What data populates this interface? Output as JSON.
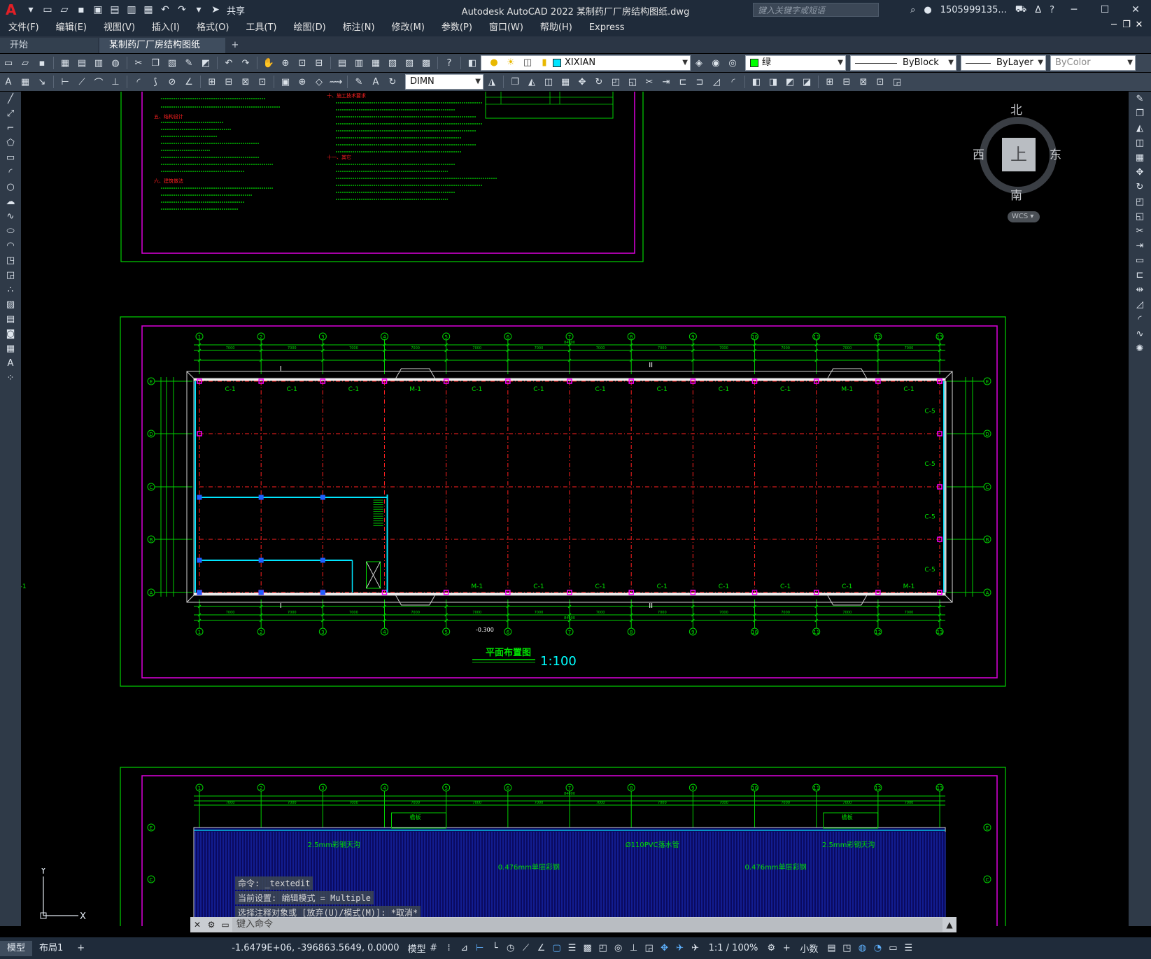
{
  "app": {
    "title": "Autodesk AutoCAD 2022    某制药厂厂房结构图纸.dwg",
    "share_label": "共享",
    "search_placeholder": "键入关键字或短语",
    "user": "1505999135...",
    "logo_letter": "A"
  },
  "menu": [
    "文件(F)",
    "编辑(E)",
    "视图(V)",
    "插入(I)",
    "格式(O)",
    "工具(T)",
    "绘图(D)",
    "标注(N)",
    "修改(M)",
    "参数(P)",
    "窗口(W)",
    "帮助(H)",
    "Express"
  ],
  "tabs": [
    {
      "label": "开始",
      "active": false
    },
    {
      "label": "某制药厂厂房结构图纸*",
      "active": true
    }
  ],
  "toolbar": {
    "layer": {
      "name": "XIXIAN",
      "color": "#00e5ff"
    },
    "color": {
      "name": "绿",
      "color": "#00ff00"
    },
    "linetype": "ByBlock",
    "lineweight": "ByLayer",
    "plotstyle": "ByColor",
    "dimstyle": "DIMN"
  },
  "viewcube": {
    "top": "上",
    "north": "北",
    "south": "南",
    "east": "东",
    "west": "西",
    "wcs": "WCS"
  },
  "ucs": {
    "x": "X",
    "y": "Y"
  },
  "drawing": {
    "plan_title": "平面布置图",
    "plan_scale": "1:100",
    "elevation_mark": "-0.300",
    "grid_numbers": [
      "1",
      "2",
      "3",
      "4",
      "5",
      "6",
      "7",
      "8",
      "9",
      "10",
      "11",
      "12",
      "13"
    ],
    "grid_letters": [
      "E",
      "D",
      "C",
      "B",
      "A"
    ],
    "top_dims": [
      "7000",
      "7000",
      "7000",
      "7000",
      "7000",
      "7000",
      "7000",
      "7000",
      "7000",
      "7000",
      "7000",
      "7000"
    ],
    "total_dim": "84000",
    "bottom_dims": [
      "7000",
      "7000",
      "7000",
      "7000",
      "7000",
      "7000",
      "7000",
      "7000",
      "7000",
      "7000",
      "7000",
      "7000"
    ],
    "window_labels_top": [
      "C-1",
      "C-1",
      "C-1",
      "M-1",
      "C-1",
      "C-1",
      "C-1",
      "C-1",
      "C-1",
      "C-1",
      "M-1",
      "C-1"
    ],
    "window_labels_bottom": [
      "M-1",
      "C-1",
      "C-1",
      "C-1",
      "C-1",
      "C-1",
      "C-1",
      "M-1",
      "C-1"
    ],
    "window_labels_right": [
      "C-5",
      "C-5",
      "C-5",
      "C-5"
    ],
    "section_labels": [
      "I",
      "II",
      "I",
      "II"
    ],
    "roof_labels": [
      "2.5mm彩钢天沟",
      "0.476mm单层彩钢",
      "Ø110PVC落水管",
      "0.476mm单层彩钢",
      "2.5mm彩钢天沟"
    ],
    "roof_small": [
      "檐板",
      "檐板"
    ],
    "notes_heading_1": "五、结构设计",
    "notes_heading_2": "六、建筑做法",
    "notes_heading_3": "十、施工技术要求",
    "notes_heading_4": "十一、其它"
  },
  "command": {
    "history": [
      "命令:  _textedit",
      "当前设置: 编辑模式 = Multiple",
      "选择注释对象或 [放弃(U)/模式(M)]: *取消*"
    ],
    "placeholder": "键入命令"
  },
  "status": {
    "layouts": [
      "模型",
      "布局1"
    ],
    "coords": "-1.6479E+06, -396863.5649, 0.0000",
    "model_label": "模型",
    "scale": "1:1 / 100%",
    "units": "小数"
  }
}
